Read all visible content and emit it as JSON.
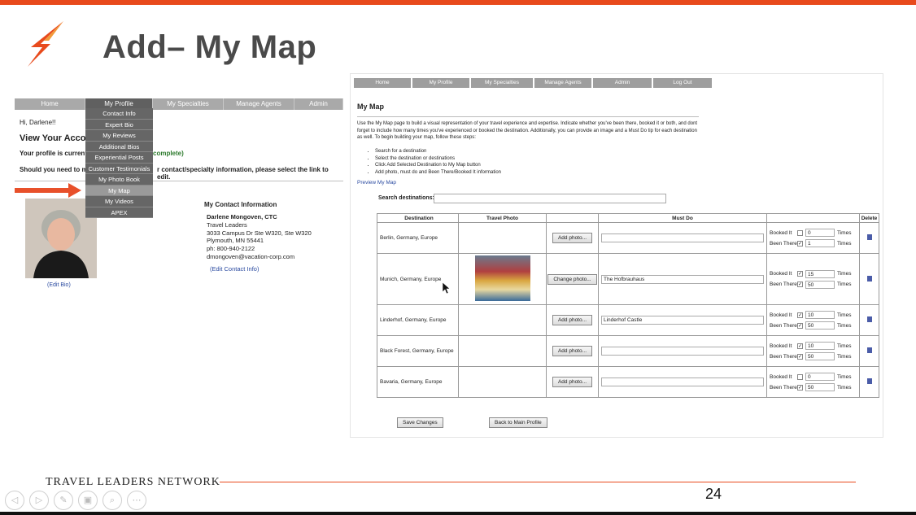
{
  "slide": {
    "title": "Add– My Map",
    "brand": "TRAVEL LEADERS NETWORK",
    "page_number": "24",
    "accent": "#e84a1c"
  },
  "left": {
    "nav": [
      "Home",
      "My Profile",
      "My Specialties",
      "Manage Agents",
      "Admin"
    ],
    "dropdown": [
      "Contact Info",
      "Expert Bio",
      "My Reviews",
      "Additional Bios",
      "Experiential Posts",
      "Customer Testimonials",
      "My Photo Book",
      "My Map",
      "My Videos",
      "APEX"
    ],
    "greeting": "Hi, Darlene!!",
    "view_heading": "View Your Accou",
    "profile_current": "Your profile is current",
    "profile_complete": "complete)",
    "should_left": "Should you need to m",
    "should_right": "r contact/specialty information, please select the link to edit.",
    "edit_bio": "(Edit Bio)",
    "contact_heading": "My Contact Information",
    "contact_name": "Darlene Mongoven, CTC",
    "contact_lines": [
      "Travel Leaders",
      "3033 Campus Dr Ste W320, Ste W320",
      "Plymouth, MN 55441",
      "ph: 800-940-2122",
      "dmongoven@vacation-corp.com"
    ],
    "edit_contact": "(Edit Contact Info)"
  },
  "right": {
    "nav": [
      "Home",
      "My Profile",
      "My Specialties",
      "Manage Agents",
      "Admin",
      "Log Out"
    ],
    "title": "My Map",
    "intro": "Use the My Map page to build a visual representation of your travel experience and expertise. Indicate whether you've been there, booked it or both, and dont forget to include how many times you've experienced or booked the destination. Additionally, you can provide an image and a Must Do tip for each destination as well. To begin building your map, follow these steps:",
    "steps": [
      "Search for a destination",
      "Select the destination or destinations",
      "Click Add Selected Destination to My Map button",
      "Add photo, must do and Been There/Booked It information"
    ],
    "preview_link": "Preview My Map",
    "search_label": "Search destinations:",
    "columns": [
      "Destination",
      "Travel Photo",
      "",
      "Must Do",
      "",
      "Delete"
    ],
    "booked_label": "Booked It",
    "been_label": "Been There",
    "times_label": "Times",
    "rows": [
      {
        "destination": "Berlin, Germany, Europe",
        "has_photo": false,
        "button": "Add photo...",
        "must_do": "",
        "booked_checked": false,
        "booked_times": "0",
        "been_checked": true,
        "been_times": "1"
      },
      {
        "destination": "Munich, Germany, Europe",
        "has_photo": true,
        "button": "Change photo...",
        "must_do": "The Hofbrauhaus",
        "booked_checked": true,
        "booked_times": "15",
        "been_checked": true,
        "been_times": "50"
      },
      {
        "destination": "Linderhof, Germany, Europe",
        "has_photo": false,
        "button": "Add photo...",
        "must_do": "Linderhof Castle",
        "booked_checked": true,
        "booked_times": "10",
        "been_checked": true,
        "been_times": "50"
      },
      {
        "destination": "Black Forest, Germany, Europe",
        "has_photo": false,
        "button": "Add photo...",
        "must_do": "",
        "booked_checked": true,
        "booked_times": "10",
        "been_checked": true,
        "been_times": "50"
      },
      {
        "destination": "Bavaria, Germany, Europe",
        "has_photo": false,
        "button": "Add photo...",
        "must_do": "",
        "booked_checked": false,
        "booked_times": "0",
        "been_checked": true,
        "been_times": "50"
      }
    ],
    "save_label": "Save Changes",
    "back_label": "Back to Main Profile"
  },
  "controls": [
    "◁",
    "▷",
    "✎",
    "▣",
    "⌕",
    "⋯"
  ]
}
